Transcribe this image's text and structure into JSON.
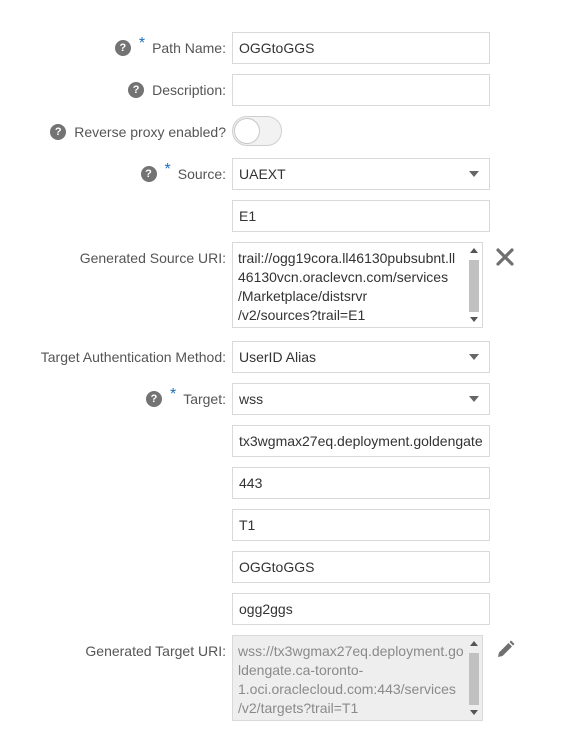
{
  "form": {
    "path_name": {
      "label": "Path Name:",
      "value": "OGGtoGGS",
      "required_mark": "*"
    },
    "description": {
      "label": "Description:",
      "value": ""
    },
    "reverse_proxy": {
      "label": "Reverse proxy enabled?",
      "enabled": false
    },
    "source": {
      "label": "Source:",
      "required_mark": "*",
      "selected": "UAEXT",
      "trail": "E1"
    },
    "generated_source_uri": {
      "label": "Generated Source URI:",
      "lines": [
        "trail://ogg19cora.ll46130pubsubnt.ll",
        "46130vcn.oraclevcn.com/services",
        "/Marketplace/distsrvr",
        "/v2/sources?trail=E1"
      ]
    },
    "target_auth": {
      "label": "Target Authentication Method:",
      "selected": "UserID Alias"
    },
    "target": {
      "label": "Target:",
      "required_mark": "*",
      "protocol": "wss",
      "host": "tx3wgmax27eq.deployment.goldengate",
      "port": "443",
      "trail": "T1",
      "domain": "OGGtoGGS",
      "alias": "ogg2ggs"
    },
    "generated_target_uri": {
      "label": "Generated Target URI:",
      "lines": [
        "wss://tx3wgmax27eq.deployment.go",
        "ldengate.ca-toronto-",
        "1.oci.oraclecloud.com:443/services",
        "/v2/targets?trail=T1"
      ]
    },
    "help_glyph": "?"
  },
  "icons": {
    "help": "question-circle-icon",
    "dropdown": "chevron-down-icon",
    "clear": "close-icon",
    "edit": "pencil-icon"
  },
  "colors": {
    "required": "#1c6fb8",
    "help_icon": "#737373",
    "border": "#d9d9d9",
    "readonly_bg": "#eeeeee",
    "action_icon": "#707070"
  }
}
